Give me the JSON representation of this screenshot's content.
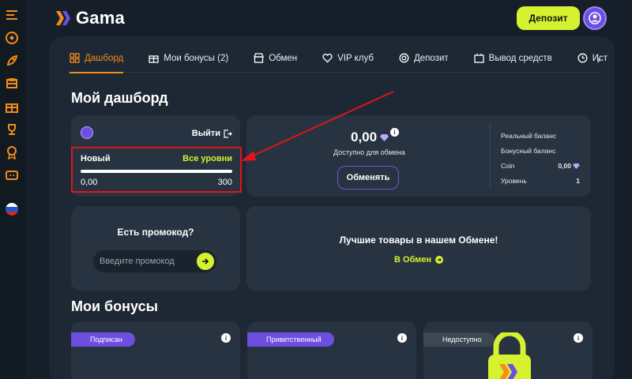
{
  "brand": {
    "name": "Gama"
  },
  "header": {
    "deposit_label": "Депозит"
  },
  "sidebar": {
    "icons": [
      "menu-icon",
      "coin-icon",
      "rocket-icon",
      "coins-stack-icon",
      "gift-icon",
      "trophy-icon",
      "medal-icon",
      "ticket-icon",
      "russia-flag-icon"
    ]
  },
  "tabs": [
    {
      "label": "Дашборд",
      "icon": "grid-icon",
      "active": true
    },
    {
      "label": "Мои бонусы (2)",
      "icon": "gift-icon"
    },
    {
      "label": "Обмен",
      "icon": "shop-icon"
    },
    {
      "label": "VIP клуб",
      "icon": "heart-icon"
    },
    {
      "label": "Депозит",
      "icon": "coins-icon"
    },
    {
      "label": "Вывод средств",
      "icon": "wallet-icon"
    },
    {
      "label": "Ист",
      "icon": "history-icon"
    }
  ],
  "dashboard": {
    "title": "Мой дашборд",
    "level_card": {
      "exit_label": "Выйти",
      "level_name": "Новый",
      "all_levels_label": "Все уровни",
      "min": "0,00",
      "max": "300",
      "progress_fraction": 0.0
    },
    "balance_card": {
      "value": "0,00",
      "subtitle": "Доступно для обмена",
      "exchange_button": "Обменять",
      "rows": [
        {
          "label": "Реальный баланс",
          "value": ""
        },
        {
          "label": "Бонусный баланс",
          "value": ""
        },
        {
          "label": "Coin",
          "value": "0,00"
        },
        {
          "label": "Уровень",
          "value": "1"
        }
      ]
    },
    "promo_card": {
      "title": "Есть промокод?",
      "placeholder": "Введите промокод"
    },
    "shop_card": {
      "title": "Лучшие товары в нашем Обмене!",
      "link_label": "В Обмен"
    }
  },
  "bonuses": {
    "title": "Мои бонусы",
    "cards": [
      {
        "badge": "Подписан",
        "badge_color": "#6c4fe0"
      },
      {
        "badge": "Приветственный",
        "badge_color": "#6c4fe0"
      },
      {
        "badge": "Недоступно",
        "badge_color": "#3c4753"
      }
    ]
  },
  "colors": {
    "accent": "#d5f130",
    "brand_orange": "#f58b1a",
    "purple": "#6c4fe0",
    "highlight_red": "#e0141b"
  }
}
